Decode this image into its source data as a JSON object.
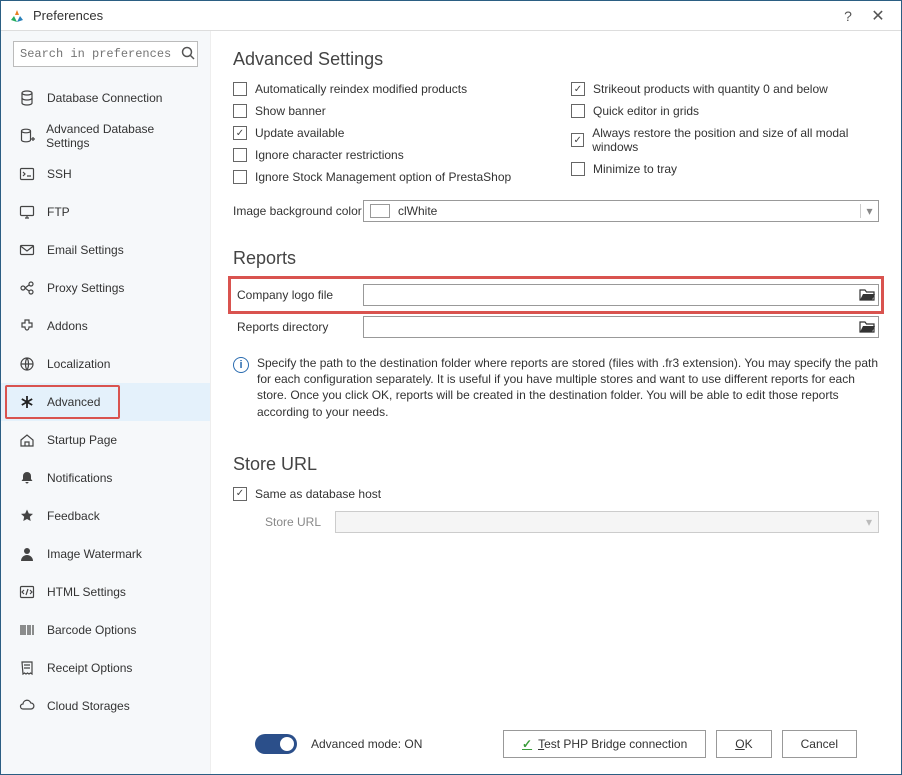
{
  "window": {
    "title": "Preferences"
  },
  "search": {
    "placeholder": "Search in preferences"
  },
  "sidebar": {
    "items": [
      {
        "label": "Database Connection",
        "icon": "database-icon"
      },
      {
        "label": "Advanced Database Settings",
        "icon": "database-plus-icon"
      },
      {
        "label": "SSH",
        "icon": "terminal-icon"
      },
      {
        "label": "FTP",
        "icon": "desktop-icon"
      },
      {
        "label": "Email Settings",
        "icon": "mail-icon"
      },
      {
        "label": "Proxy Settings",
        "icon": "proxy-icon"
      },
      {
        "label": "Addons",
        "icon": "addons-icon"
      },
      {
        "label": "Localization",
        "icon": "globe-icon"
      },
      {
        "label": "Advanced",
        "icon": "asterisk-icon",
        "active": true,
        "highlighted": true
      },
      {
        "label": "Startup Page",
        "icon": "home-icon"
      },
      {
        "label": "Notifications",
        "icon": "bell-icon"
      },
      {
        "label": "Feedback",
        "icon": "star-icon"
      },
      {
        "label": "Image Watermark",
        "icon": "person-icon"
      },
      {
        "label": "HTML Settings",
        "icon": "html-icon"
      },
      {
        "label": "Barcode Options",
        "icon": "barcode-icon"
      },
      {
        "label": "Receipt Options",
        "icon": "receipt-icon"
      },
      {
        "label": "Cloud Storages",
        "icon": "cloud-icon"
      }
    ]
  },
  "advanced": {
    "title": "Advanced Settings",
    "checks_left": [
      {
        "label": "Automatically reindex modified products",
        "checked": false
      },
      {
        "label": "Show banner",
        "checked": false
      },
      {
        "label": "Update available",
        "checked": true
      },
      {
        "label": "Ignore character restrictions",
        "checked": false
      },
      {
        "label": "Ignore Stock Management option of PrestaShop",
        "checked": false
      }
    ],
    "checks_right": [
      {
        "label": "Strikeout products with quantity 0 and below",
        "checked": true
      },
      {
        "label": "Quick editor in grids",
        "checked": false
      },
      {
        "label": "Always restore the position and size of all modal windows",
        "checked": true
      },
      {
        "label": "Minimize to tray",
        "checked": false
      }
    ],
    "bgcolor_label": "Image background color",
    "bgcolor_value": "clWhite"
  },
  "reports": {
    "title": "Reports",
    "logo_label": "Company logo file",
    "logo_value": "",
    "dir_label": "Reports directory",
    "dir_value": "",
    "info": "Specify the path to the destination folder where reports are stored (files with .fr3 extension). You may specify the path for each configuration separately. It is useful if you have multiple stores and want to use different reports for each store. Once you click OK, reports will be created in the destination folder. You will be able to edit those reports according to your needs."
  },
  "storeurl": {
    "title": "Store URL",
    "same_label": "Same as database host",
    "same_checked": true,
    "url_label": "Store URL",
    "url_value": ""
  },
  "footer": {
    "mode_label": "Advanced mode: ON",
    "test_label": "Test PHP Bridge connection",
    "ok_label": "OK",
    "cancel_label": "Cancel"
  }
}
